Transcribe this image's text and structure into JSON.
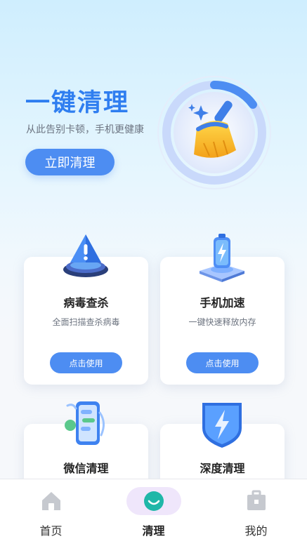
{
  "hero": {
    "title": "一键清理",
    "subtitle": "从此告别卡顿，手机更健康",
    "button_label": "立即清理",
    "icon": "broom-icon"
  },
  "cards": [
    {
      "title": "病毒查杀",
      "desc": "全面扫描查杀病毒",
      "button": "点击使用",
      "icon": "warning-shield-icon"
    },
    {
      "title": "手机加速",
      "desc": "一键快速释放内存",
      "button": "点击使用",
      "icon": "battery-boost-icon"
    },
    {
      "title": "微信清理",
      "icon": "phone-chat-icon"
    },
    {
      "title": "深度清理",
      "icon": "lightning-shield-icon"
    }
  ],
  "tabbar": {
    "items": [
      {
        "label": "首页",
        "icon": "home-icon"
      },
      {
        "label": "清理",
        "icon": "smile-icon",
        "active": true
      },
      {
        "label": "我的",
        "icon": "toolbox-icon"
      }
    ]
  },
  "colors": {
    "accent": "#4d8df2",
    "title": "#2f7ef0",
    "active_tab_bg": "#efe6fb",
    "active_icon": "#1fb7a8"
  }
}
